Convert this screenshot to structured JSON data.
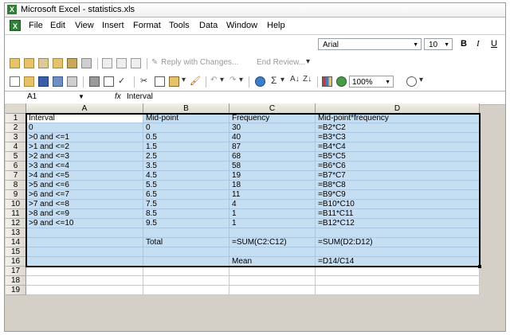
{
  "window": {
    "title": "Microsoft Excel - statistics.xls",
    "app_icon": "excel-icon"
  },
  "menu": [
    "File",
    "Edit",
    "View",
    "Insert",
    "Format",
    "Tools",
    "Data",
    "Window",
    "Help"
  ],
  "format_toolbar": {
    "font_name": "Arial",
    "font_size": "10",
    "bold": "B",
    "italic": "I",
    "underline": "U"
  },
  "reviewing_toolbar": {
    "reply": "Reply with Changes...",
    "end_review": "End Review..."
  },
  "standard_toolbar": {
    "zoom": "100%"
  },
  "formula_bar": {
    "name_box": "A1",
    "fx": "fx",
    "content": "Interval"
  },
  "columns": [
    "A",
    "B",
    "C",
    "D"
  ],
  "row_numbers": [
    "1",
    "2",
    "3",
    "4",
    "5",
    "6",
    "7",
    "8",
    "9",
    "10",
    "11",
    "12",
    "13",
    "14",
    "15",
    "16",
    "17",
    "18",
    "19"
  ],
  "cells": [
    [
      "Interval",
      "Mid-point",
      "Frequency",
      "Mid-point*frequency"
    ],
    [
      "0",
      "0",
      "30",
      "=B2*C2"
    ],
    [
      ">0 and <=1",
      "0.5",
      "40",
      "=B3*C3"
    ],
    [
      ">1 and <=2",
      "1.5",
      "87",
      "=B4*C4"
    ],
    [
      ">2 and <=3",
      "2.5",
      "68",
      "=B5*C5"
    ],
    [
      ">3 and <=4",
      "3.5",
      "58",
      "=B6*C6"
    ],
    [
      ">4 and <=5",
      "4.5",
      "19",
      "=B7*C7"
    ],
    [
      ">5 and <=6",
      "5.5",
      "18",
      "=B8*C8"
    ],
    [
      ">6 and <=7",
      "6.5",
      "11",
      "=B9*C9"
    ],
    [
      ">7 and <=8",
      "7.5",
      "4",
      "=B10*C10"
    ],
    [
      ">8 and <=9",
      "8.5",
      "1",
      "=B11*C11"
    ],
    [
      ">9 and <=10",
      "9.5",
      "1",
      "=B12*C12"
    ],
    [
      "",
      "",
      "",
      ""
    ],
    [
      "",
      "Total",
      "=SUM(C2:C12)",
      "=SUM(D2:D12)"
    ],
    [
      "",
      "",
      "",
      ""
    ],
    [
      "",
      "",
      "Mean",
      "=D14/C14"
    ],
    [
      "",
      "",
      "",
      ""
    ],
    [
      "",
      "",
      "",
      ""
    ],
    [
      "",
      "",
      "",
      ""
    ]
  ],
  "colors": {
    "selection": "#c6def2",
    "toolbar": "#ffffff",
    "header": "#ddd9cf"
  }
}
